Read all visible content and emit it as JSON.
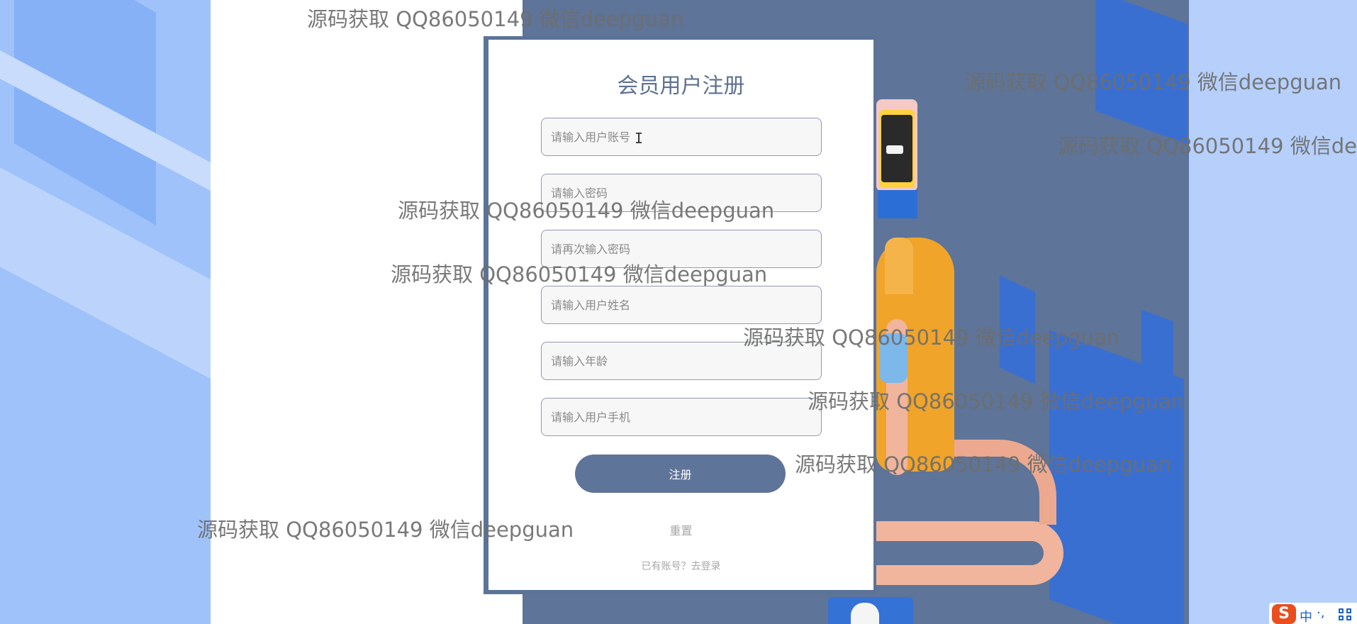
{
  "form": {
    "title": "会员用户注册",
    "username_placeholder": "请输入用户账号",
    "password_placeholder": "请输入密码",
    "confirm_password_placeholder": "请再次输入密码",
    "name_placeholder": "请输入用户姓名",
    "age_placeholder": "请输入年龄",
    "phone_placeholder": "请输入用户手机",
    "register_label": "注册",
    "reset_label": "重置",
    "login_link": "已有账号？去登录"
  },
  "watermark": {
    "text": "源码获取 QQ86050149 微信deepguan",
    "text_truncated": "源码获取 QQ86050149 微信de"
  },
  "ime": {
    "logo": "S",
    "mode": "中",
    "punct": "·,"
  },
  "colors": {
    "primary": "#5e7499",
    "title": "#5e7191",
    "background_blue": "#b4cffb",
    "art_slate": "#5e7498",
    "accent_blue": "#3a6fd2"
  }
}
